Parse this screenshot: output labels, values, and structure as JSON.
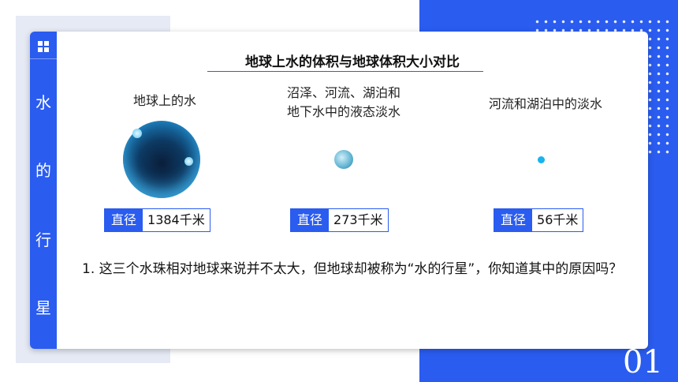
{
  "title": "地球上水的体积与地球体积大小对比",
  "sidebar": {
    "chars": [
      "水",
      "的",
      "行",
      "星"
    ]
  },
  "items": [
    {
      "label_lines": [
        "地球上的水"
      ],
      "diameter_key": "直径",
      "diameter_value": "1384千米"
    },
    {
      "label_lines": [
        "沼泽、河流、湖泊和",
        "地下水中的液态淡水"
      ],
      "diameter_key": "直径",
      "diameter_value": "273千米"
    },
    {
      "label_lines": [
        "河流和湖泊中的淡水"
      ],
      "diameter_key": "直径",
      "diameter_value": "56千米"
    }
  ],
  "question": "1. 这三个水珠相对地球来说并不太大，但地球却被称为“水的行星”，你知道其中的原因吗？",
  "page_number": "01",
  "colors": {
    "accent": "#2a5cf0",
    "panel_gray": "#e6eaf5"
  }
}
